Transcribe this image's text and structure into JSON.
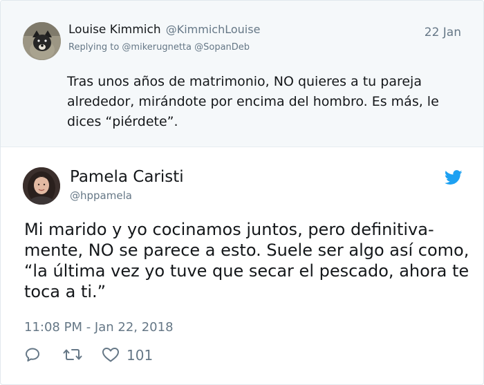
{
  "parent_tweet": {
    "display_name": "Louise Kimmich",
    "handle": "@KimmichLouise",
    "date": "22 Jan",
    "replying_to": "Replying to @mikerugnetta @SopanDeb",
    "text": "Tras unos años de matrimonio, NO quieres a tu pareja alrededor, mirándote por encima del hombro. Es más, le dices “piérdete”."
  },
  "main_tweet": {
    "display_name": "Pamela Caristi",
    "handle": "@hppamela",
    "text": "Mi marido y yo cocinamos juntos, pero definitiva­mente, NO se parece a esto. Suele ser algo así como, “la última vez yo tuve que secar el pescado, ahora te toca a ti.”",
    "timestamp": "11:08 PM - Jan 22, 2018",
    "like_count": "101"
  },
  "icons": {
    "reply": "reply-icon",
    "retweet": "retweet-icon",
    "like": "heart-icon",
    "brand": "twitter-bird-icon"
  },
  "colors": {
    "brand": "#1da1f2",
    "secondary_text": "#657786",
    "parent_background": "#f5f8fa"
  }
}
